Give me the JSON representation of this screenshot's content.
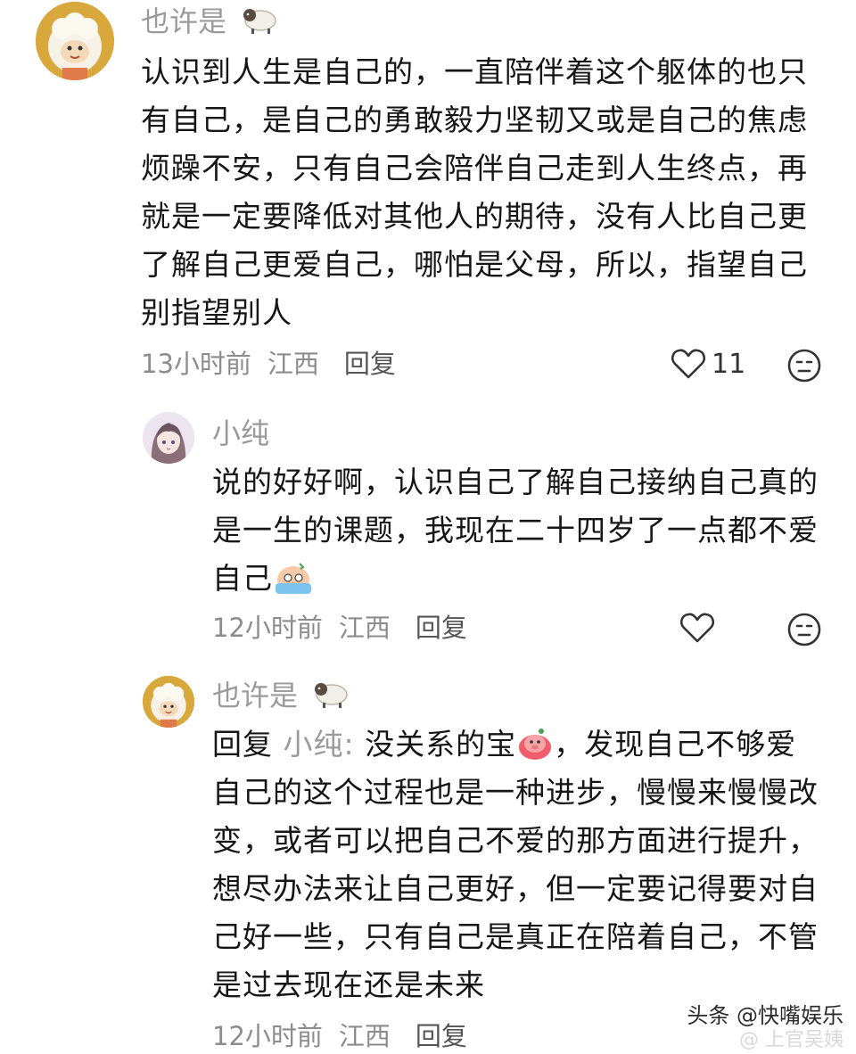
{
  "comments": [
    {
      "name": "也许是",
      "name_emoji": "sheep-emoji",
      "lines": [
        "认识到人生是自己的，一直陪伴着这个躯体的也只",
        "有自己，是自己的勇敢毅力坚韧又或是自己的焦虑",
        "烦躁不安，只有自己会陪伴自己走到人生终点，再",
        "就是一定要降低对其他人的期待，没有人比自己更",
        "了解自己更爱自己，哪怕是父母，所以，指望自己",
        "别指望别人"
      ],
      "time": "13小时前",
      "location": "江西",
      "reply_label": "回复",
      "like_count": "11"
    },
    {
      "name": "小纯",
      "lines": [
        "说的好好啊，认识自己了解自己接纳自己真的",
        "是一生的课题，我现在二十四岁了一点都不爱",
        "自己"
      ],
      "line_emoji": "crying-emoji",
      "time": "12小时前",
      "location": "江西",
      "reply_label": "回复",
      "like_count": ""
    },
    {
      "name": "也许是",
      "name_emoji": "sheep-emoji",
      "reply_prefix": "回复",
      "reply_target": "小纯:",
      "first_line_rest": "没关系的宝",
      "first_line_end": "，发现自己不够爱",
      "line_emoji": "pig-emoji",
      "lines": [
        "自己的这个过程也是一种进步，慢慢来慢慢改",
        "变，或者可以把自己不爱的那方面进行提升，",
        "想尽办法来让自己更好，但一定要记得要对自",
        "己好一些，只有自己是真正在陪着自己，不管",
        "是过去现在还是未来"
      ],
      "time": "12小时前",
      "location": "江西",
      "reply_label": "回复"
    }
  ],
  "watermark": "头条 @快嘴娱乐",
  "watermark_sub": "@ 上官吴姨"
}
